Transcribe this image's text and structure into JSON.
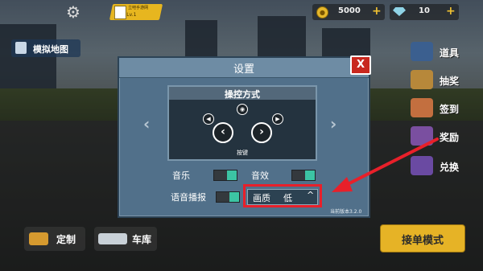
{
  "topbar": {
    "player_name": "立吧手游网",
    "player_level": "Lv.1",
    "coins": "5000",
    "gems": "10"
  },
  "left": {
    "map_label": "模拟地图"
  },
  "right_menu": [
    {
      "label": "道具",
      "icon": "bus-icon",
      "color": "#3b5f8f"
    },
    {
      "label": "抽奖",
      "icon": "lottery-icon",
      "color": "#b7883a"
    },
    {
      "label": "签到",
      "icon": "checkin-icon",
      "color": "#c36f3f"
    },
    {
      "label": "奖励",
      "icon": "reward-icon",
      "color": "#7a4fa0"
    },
    {
      "label": "兑换",
      "icon": "gift-icon",
      "color": "#6a4aa2"
    }
  ],
  "bottom": {
    "custom_label": "定制",
    "garage_label": "车库",
    "mode_label": "接单模式"
  },
  "dialog": {
    "title": "设置",
    "close_symbol": "X",
    "control_title": "操控方式",
    "control_type": "按键",
    "left_arrow": "‹",
    "right_arrow": "›",
    "nav_left": "‹",
    "nav_right": "›",
    "music_label": "音乐",
    "sfx_label": "音效",
    "voice_label": "语音播报",
    "quality_label": "画质",
    "quality_value": "低",
    "quality_caret": "^",
    "version": "当前版本3.2.0"
  },
  "colors": {
    "accent_gold": "#e6b326",
    "toggle_on": "#3cc4a4",
    "highlight_red": "#e8202a",
    "dialog_bg": "#51708a"
  }
}
